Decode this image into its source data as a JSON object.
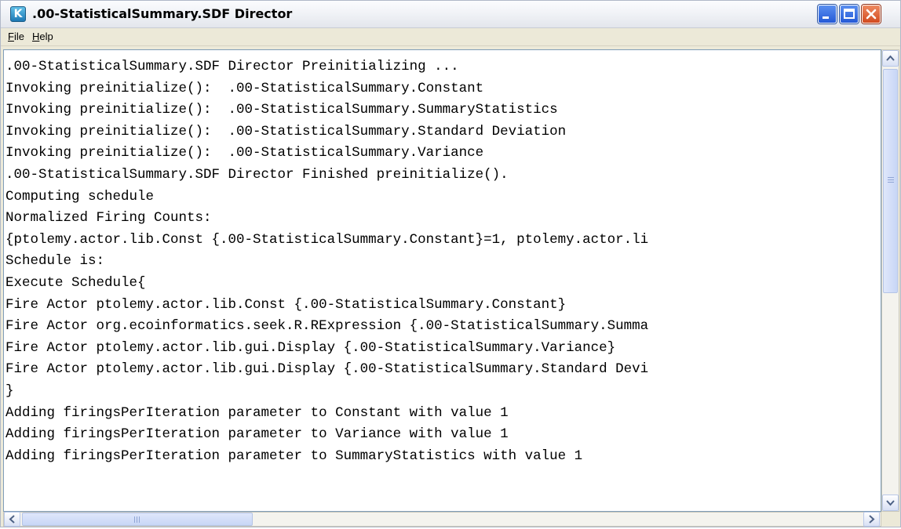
{
  "window": {
    "title": ".00-StatisticalSummary.SDF Director",
    "app_icon_letter": "K"
  },
  "menu": {
    "file": {
      "label_first": "F",
      "label_rest": "ile"
    },
    "help": {
      "label_first": "H",
      "label_rest": "elp"
    }
  },
  "console": {
    "lines": [
      ".00-StatisticalSummary.SDF Director Preinitializing ...",
      "Invoking preinitialize():  .00-StatisticalSummary.Constant",
      "Invoking preinitialize():  .00-StatisticalSummary.SummaryStatistics",
      "Invoking preinitialize():  .00-StatisticalSummary.Standard Deviation",
      "Invoking preinitialize():  .00-StatisticalSummary.Variance",
      ".00-StatisticalSummary.SDF Director Finished preinitialize().",
      "Computing schedule",
      "Normalized Firing Counts:",
      "{ptolemy.actor.lib.Const {.00-StatisticalSummary.Constant}=1, ptolemy.actor.li",
      "Schedule is:",
      "Execute Schedule{",
      "Fire Actor ptolemy.actor.lib.Const {.00-StatisticalSummary.Constant}",
      "Fire Actor org.ecoinformatics.seek.R.RExpression {.00-StatisticalSummary.Summa",
      "Fire Actor ptolemy.actor.lib.gui.Display {.00-StatisticalSummary.Variance}",
      "Fire Actor ptolemy.actor.lib.gui.Display {.00-StatisticalSummary.Standard Devi",
      "}",
      "Adding firingsPerIteration parameter to Constant with value 1",
      "Adding firingsPerIteration parameter to Variance with value 1",
      "Adding firingsPerIteration parameter to SummaryStatistics with value 1"
    ]
  },
  "colors": {
    "window_bg": "#ece9d8",
    "close_button": "#d24a1e",
    "control_button": "#2459d6",
    "console_border": "#7f9db9"
  },
  "icons": {
    "app": "kepler-k-icon",
    "minimize": "minimize-icon",
    "maximize": "maximize-icon",
    "close": "close-icon",
    "scroll_up": "arrow-up-icon",
    "scroll_down": "arrow-down-icon",
    "scroll_left": "arrow-left-icon",
    "scroll_right": "arrow-right-icon"
  }
}
